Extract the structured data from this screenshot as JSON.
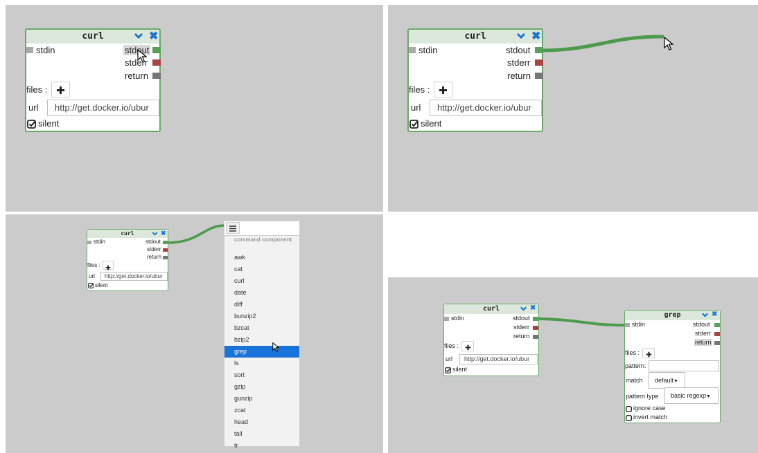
{
  "node_curl": {
    "title": "curl",
    "stdin": "stdin",
    "stdout": "stdout",
    "stderr": "stderr",
    "return": "return",
    "files_label": "files :",
    "url_label": "url",
    "url_value": "http://get.docker.io/ubur",
    "silent_label": "silent"
  },
  "dropdown": {
    "header": "command component",
    "items": [
      "awk",
      "cat",
      "curl",
      "date",
      "diff",
      "bunzip2",
      "bzcat",
      "bzip2",
      "grep",
      "ls",
      "sort",
      "gzip",
      "gunzip",
      "zcat",
      "head",
      "tail",
      "tr"
    ],
    "selected": "grep"
  },
  "node_grep": {
    "title": "grep",
    "stdin": "stdin",
    "stdout": "stdout",
    "stderr": "stderr",
    "return": "return",
    "files_label": "files :",
    "pattern_label": "pattern:",
    "match_label": "match",
    "match_value": "default",
    "pattern_type_label": "pattern type",
    "pattern_type_value": "basic regexp",
    "ignore_case_label": "ignore case",
    "invert_match_label": "invert match"
  },
  "colors": {
    "stdout": "#56a356",
    "stderr": "#a84444",
    "return": "#767676",
    "stdin": "#a9a9a9",
    "wire": "#4d9a4d",
    "accent": "#1b75d0"
  },
  "icons": [
    "chevron-down-icon",
    "close-icon",
    "plus-icon",
    "checkbox-checked-icon",
    "checkbox-empty-icon",
    "menu-icon",
    "caret-down-icon",
    "mouse-cursor-icon"
  ]
}
